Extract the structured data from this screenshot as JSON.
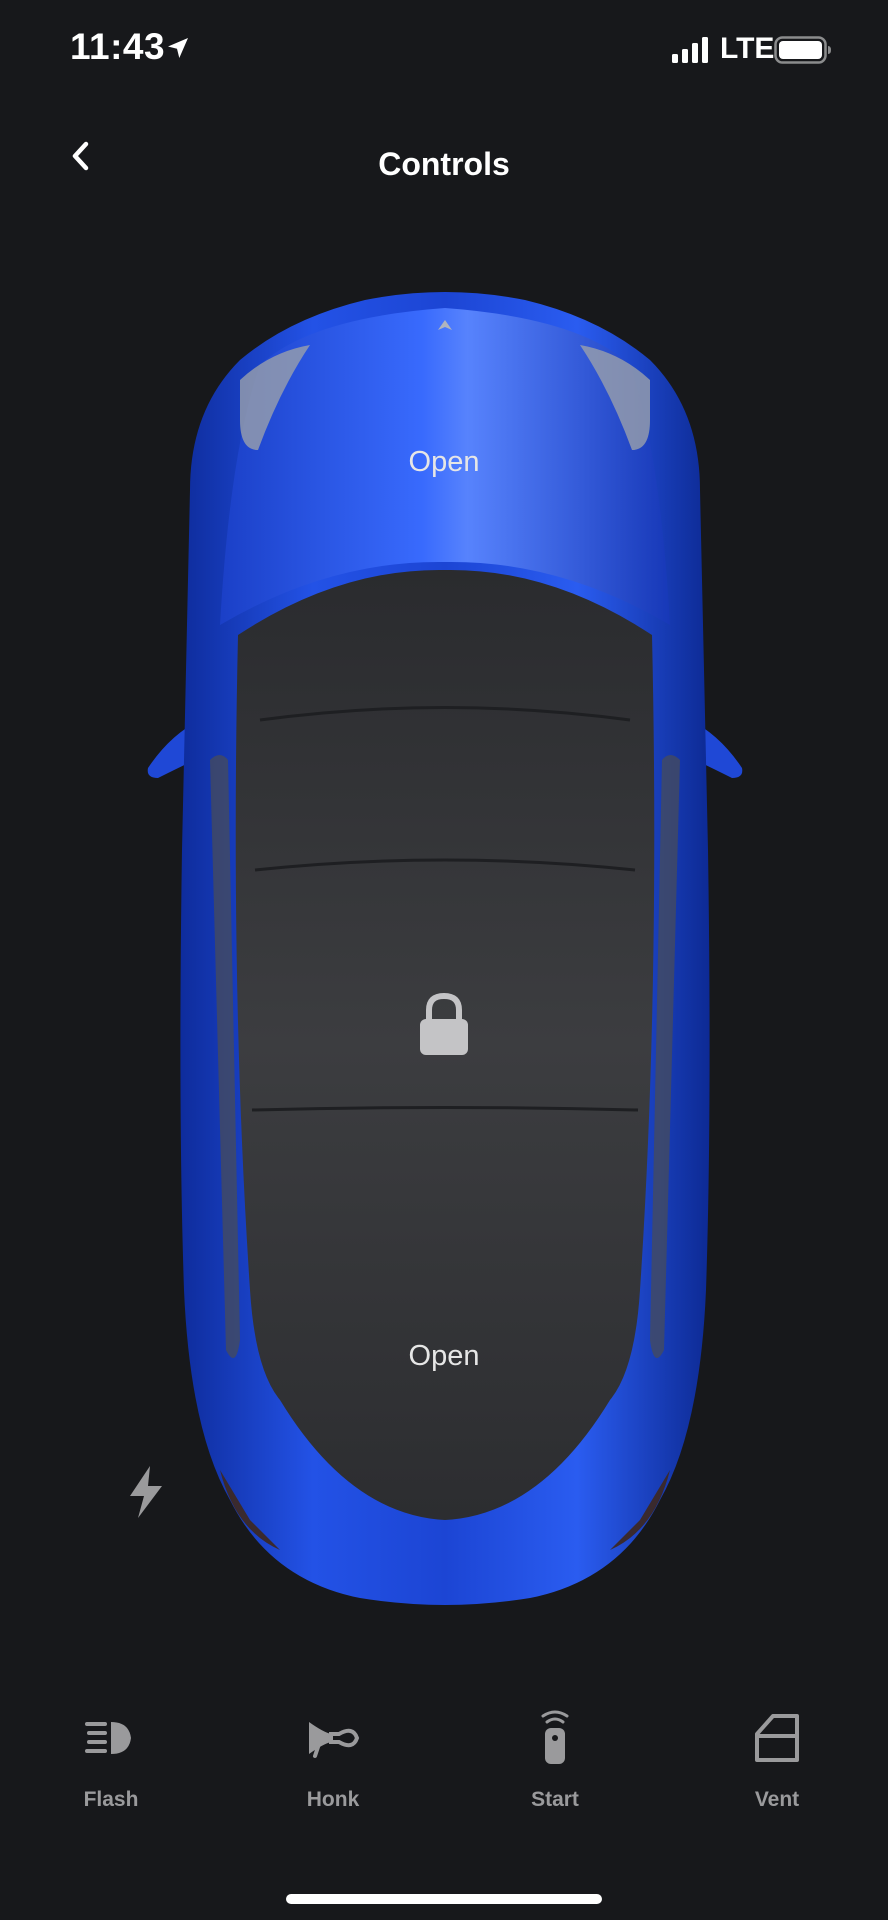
{
  "status_bar": {
    "time": "11:43",
    "location_icon": "location-arrow-icon",
    "signal_icon": "cellular-signal-icon",
    "network": "LTE",
    "battery_icon": "battery-full-icon"
  },
  "header": {
    "back_icon": "chevron-left-icon",
    "title": "Controls"
  },
  "car": {
    "color": "#1f48d6",
    "frunk_label": "Open",
    "trunk_label": "Open",
    "lock_icon": "lock-icon",
    "charge_icon": "lightning-bolt-icon"
  },
  "actions": [
    {
      "label": "Flash",
      "icon": "headlight-icon"
    },
    {
      "label": "Honk",
      "icon": "horn-icon"
    },
    {
      "label": "Start",
      "icon": "key-fob-icon"
    },
    {
      "label": "Vent",
      "icon": "window-vent-icon"
    }
  ],
  "colors": {
    "background": "#17181b",
    "icon_gray": "#9a9a9c",
    "text_white": "#ffffff"
  }
}
